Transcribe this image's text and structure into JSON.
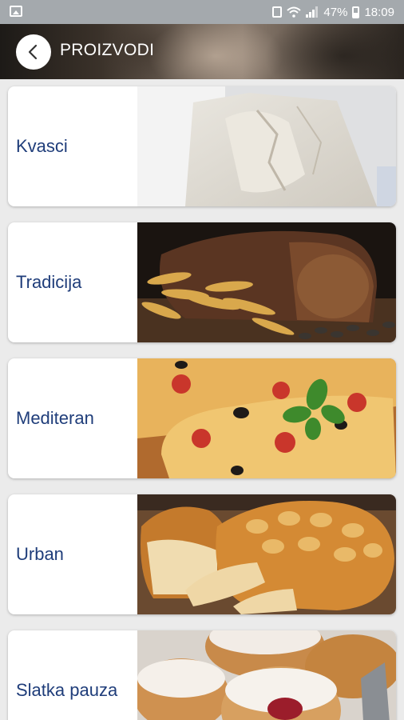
{
  "status_bar": {
    "battery_percent": "47%",
    "time": "18:09",
    "icons": [
      "image-icon",
      "alarm-icon",
      "wifi-icon",
      "signal-icon",
      "battery-icon"
    ]
  },
  "header": {
    "title": "PROIZVODI",
    "back_icon": "chevron-left-icon"
  },
  "products": [
    {
      "label": "Kvasci",
      "image": "yeast-block-photo"
    },
    {
      "label": "Tradicija",
      "image": "rye-bread-wheat-photo"
    },
    {
      "label": "Mediteran",
      "image": "focaccia-photo"
    },
    {
      "label": "Urban",
      "image": "white-bread-loaves-photo"
    },
    {
      "label": "Slatka pauza",
      "image": "donuts-photo"
    }
  ],
  "colors": {
    "label_text": "#1f3d7a",
    "status_bar": "#a4a9ad",
    "background": "#ebebeb"
  }
}
